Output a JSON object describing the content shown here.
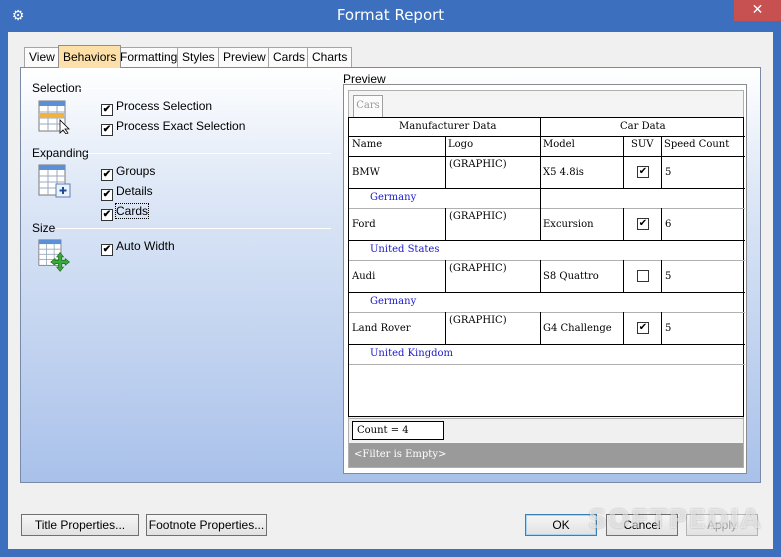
{
  "window": {
    "title": "Format Report",
    "close_glyph": "✕",
    "app_icon": "gear-icon"
  },
  "tabs": [
    "View",
    "Behaviors",
    "Formatting",
    "Styles",
    "Preview",
    "Cards",
    "Charts"
  ],
  "active_tab": "Behaviors",
  "behaviors": {
    "selection": {
      "label": "Selection",
      "options": [
        {
          "label": "Process Selection",
          "checked": true
        },
        {
          "label": "Process Exact Selection",
          "checked": true
        }
      ]
    },
    "expanding": {
      "label": "Expanding",
      "options": [
        {
          "label": "Groups",
          "checked": true
        },
        {
          "label": "Details",
          "checked": true
        },
        {
          "label": "Cards",
          "checked": true
        }
      ]
    },
    "size": {
      "label": "Size",
      "options": [
        {
          "label": "Auto Width",
          "checked": true
        }
      ]
    }
  },
  "preview": {
    "label": "Preview",
    "tab": "Cars",
    "band_headers": [
      "Manufacturer Data",
      "Car Data"
    ],
    "columns": [
      "Name",
      "Logo",
      "Model",
      "SUV",
      "Speed Count"
    ],
    "rows": [
      {
        "name": "BMW",
        "logo": "(GRAPHIC)",
        "model": "X5 4.8is",
        "suv": true,
        "speed": "5",
        "group": "Germany"
      },
      {
        "name": "Ford",
        "logo": "(GRAPHIC)",
        "model": "Excursion",
        "suv": true,
        "speed": "6",
        "group": "United States"
      },
      {
        "name": "Audi",
        "logo": "(GRAPHIC)",
        "model": "S8 Quattro",
        "suv": false,
        "speed": "5",
        "group": "Germany"
      },
      {
        "name": "Land Rover",
        "logo": "(GRAPHIC)",
        "model": "G4 Challenge",
        "suv": true,
        "speed": "5",
        "group": "United Kingdom"
      }
    ],
    "count": "Count = 4",
    "filter": "<Filter is Empty>"
  },
  "buttons": {
    "title_properties": "Title Properties...",
    "footnote_properties": "Footnote Properties...",
    "ok": "OK",
    "cancel": "Cancel",
    "apply": "Apply"
  },
  "watermark": "SOFTPEDIA",
  "colors": {
    "title_bar": "#3c6fbd",
    "active_tab": "#fce0a8",
    "group_text": "#1a1acc",
    "close_button": "#c75050"
  }
}
